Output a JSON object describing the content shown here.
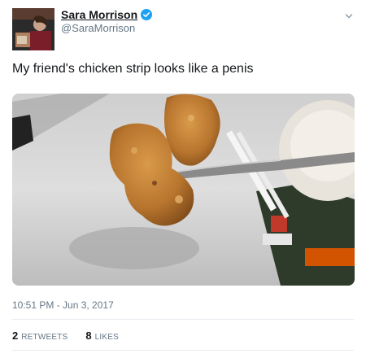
{
  "user": {
    "display_name": "Sara Morrison",
    "handle": "@SaraMorrison",
    "verified_icon": "verified-badge-icon",
    "avatar_icon": "avatar"
  },
  "tweet": {
    "text": "My friend's chicken strip looks like a penis",
    "timestamp": "10:51 PM - Jun 3, 2017"
  },
  "menu_icon": "chevron-down-icon",
  "stats": {
    "retweets_count": "2",
    "retweets_label": "RETWEETS",
    "likes_count": "8",
    "likes_label": "LIKES"
  },
  "colors": {
    "accent": "#1da1f2",
    "text": "#14171a",
    "muted": "#657786"
  }
}
